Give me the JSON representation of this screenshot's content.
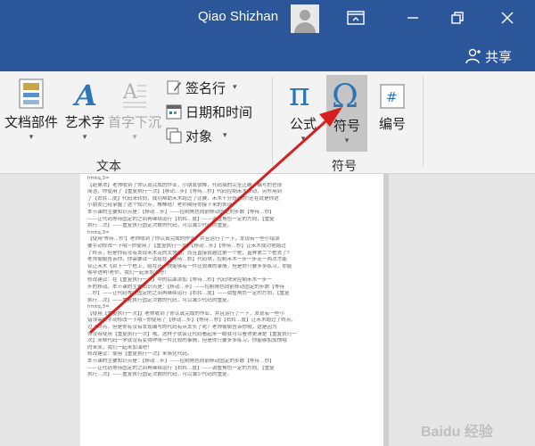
{
  "titlebar": {
    "user_name": "Qiao Shizhan"
  },
  "sharebar": {
    "share_label": "共享"
  },
  "ribbon": {
    "text_group": {
      "label": "文本",
      "doc_parts": "文档部件",
      "wordart": "艺术字",
      "dropcap": "首字下沉",
      "signature": "签名行",
      "datetime": "日期和时间",
      "object": "对象"
    },
    "symbol_group": {
      "label": "符号",
      "equation": "公式",
      "symbol": "符号",
      "number": "编号"
    }
  },
  "document": {
    "lines": [
      "hmtq,3=",
      "【赵桌浓】老帅收到了你认真完成的作业，小朋友很棒，代码填的完全正确，编写的也很",
      "简洁，你使用了【重复执行一次】【移动…步】【等待…秒】代码控制禾木移动，另外用到",
      "了【右转…度】代码来转向，成功帮助禾木跑过了比赛，禾木十分感谢你!还在说是你这",
      "小朋友已经掌握了这个知识点，棒棒哒！老师期待你接下来的表现!",
      "本节课的主要知识点是：【移动…步】——控制角色向前移动固定的步数【等待…秒】",
      "——让代码等待固定的之间再继续运行【右转…度】——调整角色一定的方向，【重复",
      "执行…次】——重复执行固定次数的代码，可以减少代码的重复。",
      "hmtq,3=",
      "【使用'等待…秒'】老帅收到了你认真完成的作业，并且运行了一下，发现有一些小错误",
      "要手动修改一下哦~你使用了【重复执行一次】【移动…步】【等待…秒】让禾木成功地跑过",
      "了终点，但是你有没有发现禾木走的太快啦，而且直接就越过第一个桩，直奔第二个桩去了?",
      "老师偷偷告诉你，你需要试一试给在【等待…秒】代码块，控制禾木一步一步走一两次才能",
      "合让禾木飞到下一个桩上，给在还一快能够有一件比较难的事情，但是你只要多多练习，你能",
      "够早进哟!老师，我们一起来加油吧!",
      "修改建议：在【重复执行一次】中的后面添加【等待…秒】代码块来控制禾木一步一",
      "步的移动。本节课的主要知识点是：【移动…步】——控制角色向前移动固定的步数【等待",
      "…秒】——让代码等待固定的之间再继续运行【右转…度】——调整角色一定的方向，【重复",
      "执行…次】——重复执行固定次数的代码，可以减少代码的重复。",
      "hmtq,3=",
      "【使用【重复执行一次】】老帅收到了你认真完成的作业，并且运行了一下，发现有一些小",
      "错误需要手动修改一下哦~你使用了【移动…步】【等待…秒】【右转…度】让禾木跑过了终点，",
      "过了终点，但是你有没有发现编写的代码有点太长了呢？老帅偷偷告诉你哦，这是因为",
      "你没有使用【重复执行一次】哦，这样子就会让代码看起来一眼就可以看得更清楚【重复执行一",
      "次】来帮代码一学就没有变得啰嗦一件比较的事情，但是你只要多多练习，你能够加加快哦",
      "时来米，我们一起来加油吧!",
      "修改建议：使用【重复执行一次】来简化代码。",
      "本节课的主要知识点是：【移动…步】——控制角色向前移动固定的步数【等待…秒】",
      "——让代码等待固定的之间再继续运行【右转…度】——调整角色一定的方向，【重复",
      "执行…次】——重复执行固定次数的代码，可以减少代码的重复。"
    ]
  },
  "watermark": {
    "text": "Baidu 经验"
  },
  "colors": {
    "title_bar": "#2b579a",
    "annotation_arrow": "#d62020"
  }
}
